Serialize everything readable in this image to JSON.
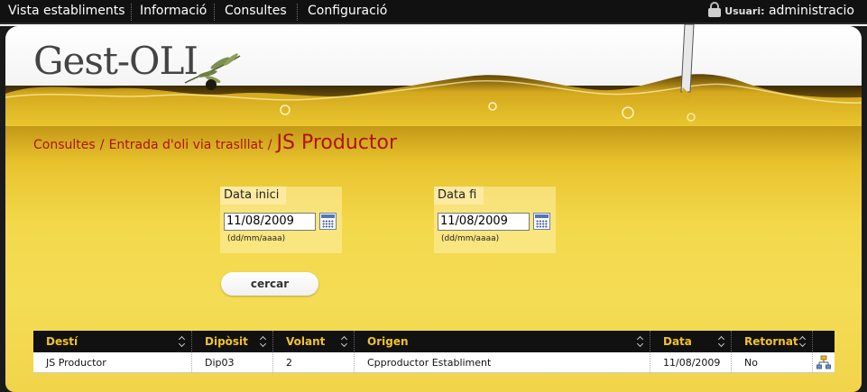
{
  "nav": {
    "items": [
      {
        "label": "Vista establiments"
      },
      {
        "label": "Informació"
      },
      {
        "label": "Consultes"
      },
      {
        "label": "Configuració"
      }
    ],
    "user_label": "Usuari:",
    "user_name": "administracio"
  },
  "brand": {
    "logo_text": "Gest-OLI"
  },
  "breadcrumb": {
    "items": [
      "Consultes",
      "Entrada d'oli via traslllat"
    ],
    "separator": "/",
    "current": "JS Productor"
  },
  "filters": {
    "start": {
      "title": "Data inici",
      "value": "11/08/2009",
      "hint": "(dd/mm/aaaa)"
    },
    "end": {
      "title": "Data fi",
      "value": "11/08/2009",
      "hint": "(dd/mm/aaaa)"
    },
    "search_label": "cercar"
  },
  "table": {
    "columns": [
      "Destí",
      "Dipòsit",
      "Volant",
      "Origen",
      "Data",
      "Retornat"
    ],
    "rows": [
      [
        "JS Productor",
        "Dip03",
        "2",
        "Cpproductor Establiment",
        "11/08/2009",
        "No"
      ]
    ]
  },
  "colors": {
    "accent": "#b01313",
    "header_text": "#f3c22a",
    "oil": "#f2d44a"
  }
}
